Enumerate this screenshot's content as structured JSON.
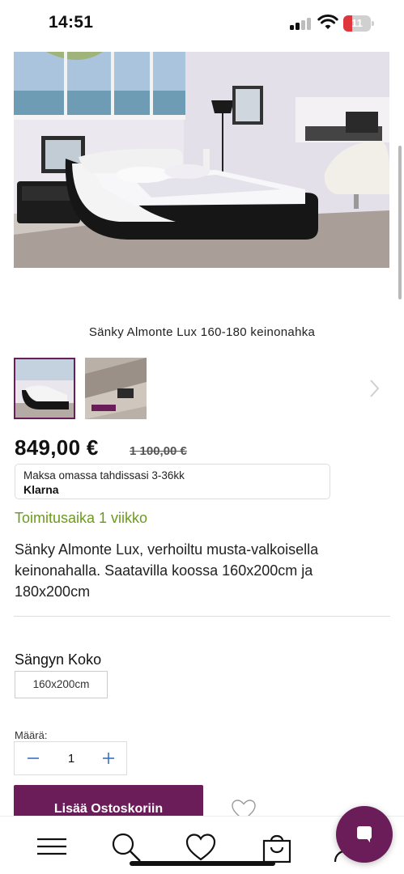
{
  "status_bar": {
    "time": "14:51",
    "battery_level": "11",
    "icons": [
      "signal-icon",
      "wifi-icon",
      "battery-icon"
    ]
  },
  "product": {
    "title": "Sänky Almonte Lux 160-180 keinonahka",
    "price": "849,00 €",
    "old_price": "1 100,00 €",
    "klarna_text": "Maksa omassa tahdissasi 3-36kk",
    "klarna_logo": "Klarna",
    "delivery": "Toimitusaika 1 viikko",
    "description": "Sänky Almonte Lux, verhoiltu musta-valkoisella keinonahalla. Saatavilla koossa 160x200cm ja 180x200cm"
  },
  "gallery": {
    "thumbnail_count": 2,
    "selected_index": 0
  },
  "options": {
    "size_label": "Sängyn Koko",
    "size_selected": "160x200cm",
    "quantity_label": "Määrä:",
    "quantity_value": "1"
  },
  "actions": {
    "add_to_cart_label": "Lisää Ostoskoriin"
  },
  "bottom_nav": {
    "items": [
      "menu-icon",
      "search-icon",
      "heart-icon",
      "shopping-bag-icon",
      "user-icon"
    ]
  },
  "colors": {
    "brand": "#6b1d5a",
    "delivery_green": "#6c9a1e",
    "battery_low": "#e0353a"
  }
}
